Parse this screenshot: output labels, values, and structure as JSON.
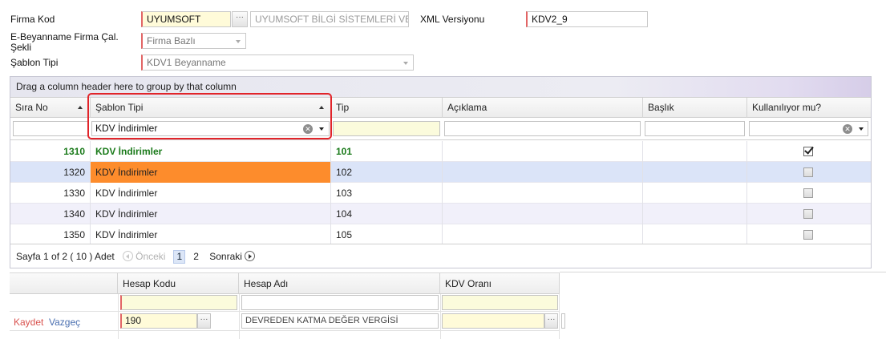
{
  "form": {
    "firma_kod_label": "Firma Kod",
    "firma_kod_value": "UYUMSOFT",
    "firma_name_value": "UYUMSOFT BİLGİ SİSTEMLERİ VE",
    "xml_label": "XML Versiyonu",
    "xml_value": "KDV2_9",
    "calisma_label": "E-Beyanname Firma Çal. Şekli",
    "calisma_value": "Firma Bazlı",
    "sablon_label": "Şablon Tipi",
    "sablon_value": "KDV1 Beyanname"
  },
  "grid": {
    "group_panel_text": "Drag a column header here to group by that column",
    "columns": [
      "Sıra No",
      "Şablon Tipi",
      "Tip",
      "Açıklama",
      "Başlık",
      "Kullanılıyor mu?"
    ],
    "filter_sablon_value": "KDV İndirimler",
    "rows": [
      {
        "sira": "1310",
        "sablon": "KDV İndirimler",
        "tip": "101",
        "aciklama": "",
        "baslik": "",
        "kullaniliyor": true
      },
      {
        "sira": "1320",
        "sablon": "KDV İndirimler",
        "tip": "102",
        "aciklama": "",
        "baslik": "",
        "kullaniliyor": false
      },
      {
        "sira": "1330",
        "sablon": "KDV İndirimler",
        "tip": "103",
        "aciklama": "",
        "baslik": "",
        "kullaniliyor": false
      },
      {
        "sira": "1340",
        "sablon": "KDV İndirimler",
        "tip": "104",
        "aciklama": "",
        "baslik": "",
        "kullaniliyor": false
      },
      {
        "sira": "1350",
        "sablon": "KDV İndirimler",
        "tip": "105",
        "aciklama": "",
        "baslik": "",
        "kullaniliyor": false
      }
    ],
    "pager": {
      "summary": "Sayfa 1 of 2 ( 10 ) Adet",
      "prev": "Önceki",
      "page1": "1",
      "page2": "2",
      "next": "Sonraki"
    }
  },
  "detail": {
    "columns": [
      "",
      "Hesap Kodu",
      "Hesap Adı",
      "KDV Oranı"
    ],
    "save": "Kaydet",
    "cancel": "Vazgeç",
    "hesap_kodu_value": "190",
    "hesap_adi_value": "DEVREDEN KATMA DEĞER VERGİSİ"
  },
  "colors": {
    "selected_row": "#dbe4f8",
    "orange_cell": "#fd8c2c",
    "green_text": "#1a7a1a",
    "highlight": "#e1242a"
  }
}
